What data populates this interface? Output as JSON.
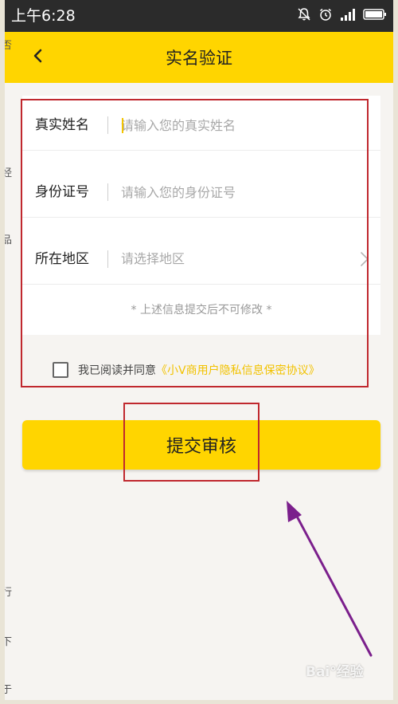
{
  "status_bar": {
    "time": "上午6:28",
    "icons": [
      "notification-off-icon",
      "alarm-icon",
      "signal-icon",
      "battery-icon"
    ]
  },
  "nav": {
    "title": "实名验证",
    "back_icon": "chevron-left-icon"
  },
  "form": {
    "fields": [
      {
        "label": "真实姓名",
        "value": "",
        "placeholder": "请输入您的真实姓名"
      },
      {
        "label": "身份证号",
        "value": "",
        "placeholder": "请输入您的身份证号"
      },
      {
        "label": "所在地区",
        "value": "请选择地区",
        "icon": "chevron-right-icon"
      }
    ],
    "note": "* 上述信息提交后不可修改 *"
  },
  "agreement": {
    "checked": false,
    "text": "我已阅读并同意",
    "link_text": "《小V商用户隐私信息保密协议》"
  },
  "submit": {
    "label": "提交审核"
  },
  "colors": {
    "accent": "#ffd500",
    "link": "#f2c200",
    "annotation_box": "#c0282e",
    "annotation_arrow": "#7b1f8c"
  },
  "watermark": "Bai°经验",
  "left_edge_fragments": [
    "否",
    "经",
    "品",
    "行",
    "下",
    "于"
  ]
}
